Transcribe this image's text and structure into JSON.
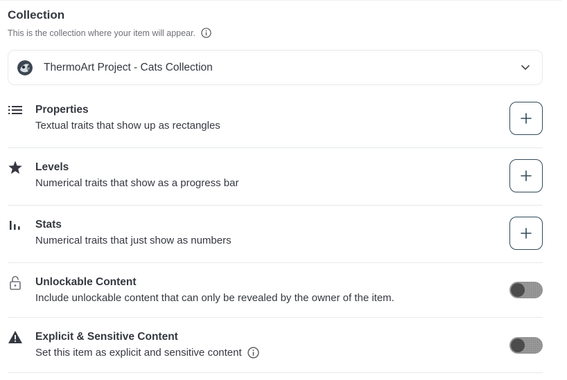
{
  "collection": {
    "title": "Collection",
    "subtitle": "This is the collection where your item will appear.",
    "selected": "ThermoArt Project - Cats Collection"
  },
  "traits": [
    {
      "title": "Properties",
      "desc": "Textual traits that show up as rectangles",
      "icon": "list-icon"
    },
    {
      "title": "Levels",
      "desc": "Numerical traits that show as a progress bar",
      "icon": "star-icon"
    },
    {
      "title": "Stats",
      "desc": "Numerical traits that just show as numbers",
      "icon": "bar-chart-icon"
    }
  ],
  "unlockable": {
    "title": "Unlockable Content",
    "desc": "Include unlockable content that can only be revealed by the owner of the item.",
    "enabled": false
  },
  "explicit": {
    "title": "Explicit & Sensitive Content",
    "desc": "Set this item as explicit and sensitive content",
    "enabled": false
  },
  "colors": {
    "text": "#353840",
    "muted": "#6e7079",
    "border": "#e5e8eb",
    "button_border": "#2f4a57"
  }
}
